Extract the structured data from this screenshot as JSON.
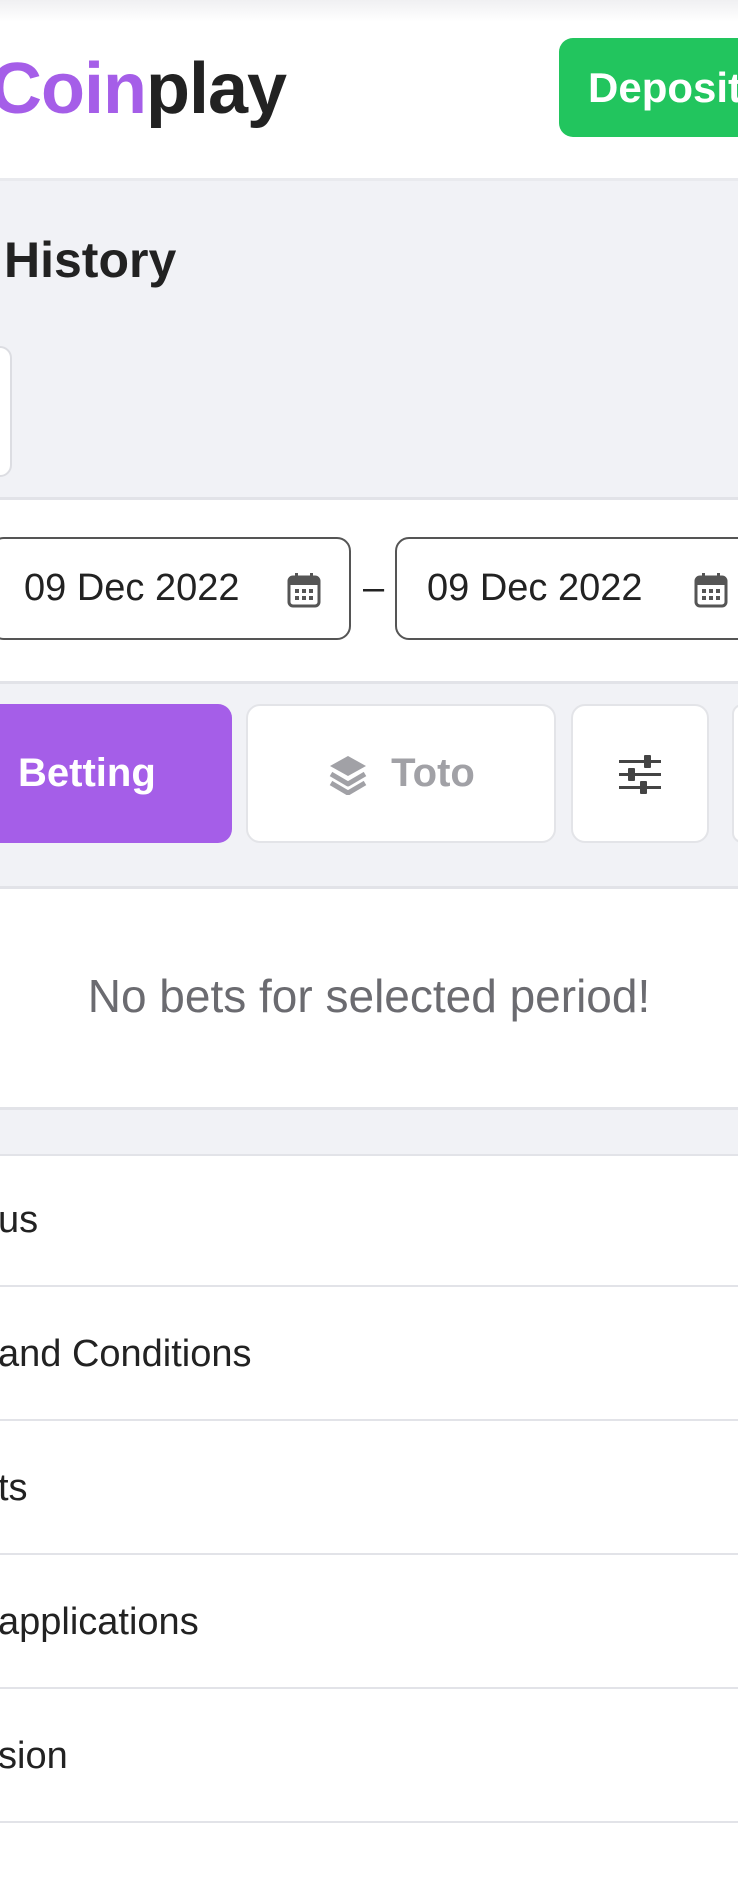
{
  "header": {
    "logo_part1": "Coin",
    "logo_part2": "play",
    "deposit_label": "Deposit"
  },
  "page": {
    "title": "History"
  },
  "date_range": {
    "from": "09 Dec 2022",
    "separator": "–",
    "to": "09 Dec 2022"
  },
  "tabs": [
    {
      "label": "Betting",
      "active": true
    },
    {
      "label": "Toto",
      "active": false
    }
  ],
  "empty_message": "No bets for selected period!",
  "footer_links": [
    {
      "label": "us"
    },
    {
      "label": "and Conditions"
    },
    {
      "label": "ts"
    },
    {
      "label": "applications"
    },
    {
      "label": "sion"
    }
  ],
  "colors": {
    "brand_purple": "#a55ee8",
    "deposit_green": "#22c55e"
  }
}
